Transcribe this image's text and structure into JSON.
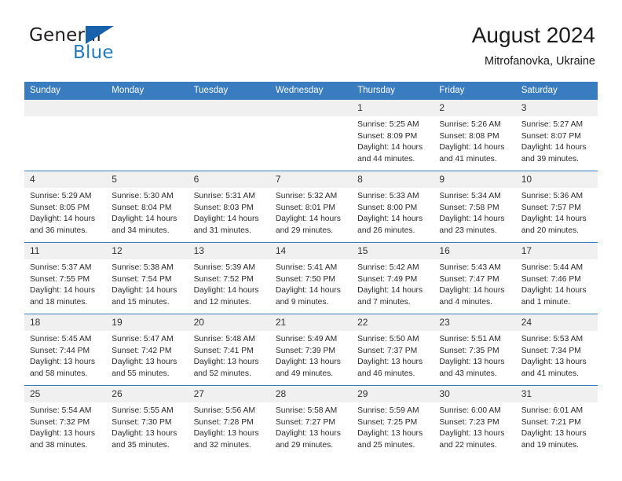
{
  "brand": {
    "name_part1": "General",
    "name_part2": "Blue",
    "triangle_color": "#1862ab",
    "blue_text_color": "#1f7bc1"
  },
  "header": {
    "title": "August 2024",
    "subtitle": "Mitrofanovka, Ukraine"
  },
  "theme": {
    "header_row_bg": "#3a7cc0",
    "daynum_bg": "#f0f0f0",
    "grid_line": "#3a7cc0",
    "text": "#2b2b2b"
  },
  "weekday_headers": [
    "Sunday",
    "Monday",
    "Tuesday",
    "Wednesday",
    "Thursday",
    "Friday",
    "Saturday"
  ],
  "labels": {
    "sunrise_prefix": "Sunrise:",
    "sunset_prefix": "Sunset:",
    "daylight_prefix": "Daylight:"
  },
  "weeks": [
    [
      {
        "day": "",
        "empty": true
      },
      {
        "day": "",
        "empty": true
      },
      {
        "day": "",
        "empty": true
      },
      {
        "day": "",
        "empty": true
      },
      {
        "day": "1",
        "sunrise": "Sunrise: 5:25 AM",
        "sunset": "Sunset: 8:09 PM",
        "daylight": "Daylight: 14 hours and 44 minutes."
      },
      {
        "day": "2",
        "sunrise": "Sunrise: 5:26 AM",
        "sunset": "Sunset: 8:08 PM",
        "daylight": "Daylight: 14 hours and 41 minutes."
      },
      {
        "day": "3",
        "sunrise": "Sunrise: 5:27 AM",
        "sunset": "Sunset: 8:07 PM",
        "daylight": "Daylight: 14 hours and 39 minutes."
      }
    ],
    [
      {
        "day": "4",
        "sunrise": "Sunrise: 5:29 AM",
        "sunset": "Sunset: 8:05 PM",
        "daylight": "Daylight: 14 hours and 36 minutes."
      },
      {
        "day": "5",
        "sunrise": "Sunrise: 5:30 AM",
        "sunset": "Sunset: 8:04 PM",
        "daylight": "Daylight: 14 hours and 34 minutes."
      },
      {
        "day": "6",
        "sunrise": "Sunrise: 5:31 AM",
        "sunset": "Sunset: 8:03 PM",
        "daylight": "Daylight: 14 hours and 31 minutes."
      },
      {
        "day": "7",
        "sunrise": "Sunrise: 5:32 AM",
        "sunset": "Sunset: 8:01 PM",
        "daylight": "Daylight: 14 hours and 29 minutes."
      },
      {
        "day": "8",
        "sunrise": "Sunrise: 5:33 AM",
        "sunset": "Sunset: 8:00 PM",
        "daylight": "Daylight: 14 hours and 26 minutes."
      },
      {
        "day": "9",
        "sunrise": "Sunrise: 5:34 AM",
        "sunset": "Sunset: 7:58 PM",
        "daylight": "Daylight: 14 hours and 23 minutes."
      },
      {
        "day": "10",
        "sunrise": "Sunrise: 5:36 AM",
        "sunset": "Sunset: 7:57 PM",
        "daylight": "Daylight: 14 hours and 20 minutes."
      }
    ],
    [
      {
        "day": "11",
        "sunrise": "Sunrise: 5:37 AM",
        "sunset": "Sunset: 7:55 PM",
        "daylight": "Daylight: 14 hours and 18 minutes."
      },
      {
        "day": "12",
        "sunrise": "Sunrise: 5:38 AM",
        "sunset": "Sunset: 7:54 PM",
        "daylight": "Daylight: 14 hours and 15 minutes."
      },
      {
        "day": "13",
        "sunrise": "Sunrise: 5:39 AM",
        "sunset": "Sunset: 7:52 PM",
        "daylight": "Daylight: 14 hours and 12 minutes."
      },
      {
        "day": "14",
        "sunrise": "Sunrise: 5:41 AM",
        "sunset": "Sunset: 7:50 PM",
        "daylight": "Daylight: 14 hours and 9 minutes."
      },
      {
        "day": "15",
        "sunrise": "Sunrise: 5:42 AM",
        "sunset": "Sunset: 7:49 PM",
        "daylight": "Daylight: 14 hours and 7 minutes."
      },
      {
        "day": "16",
        "sunrise": "Sunrise: 5:43 AM",
        "sunset": "Sunset: 7:47 PM",
        "daylight": "Daylight: 14 hours and 4 minutes."
      },
      {
        "day": "17",
        "sunrise": "Sunrise: 5:44 AM",
        "sunset": "Sunset: 7:46 PM",
        "daylight": "Daylight: 14 hours and 1 minute."
      }
    ],
    [
      {
        "day": "18",
        "sunrise": "Sunrise: 5:45 AM",
        "sunset": "Sunset: 7:44 PM",
        "daylight": "Daylight: 13 hours and 58 minutes."
      },
      {
        "day": "19",
        "sunrise": "Sunrise: 5:47 AM",
        "sunset": "Sunset: 7:42 PM",
        "daylight": "Daylight: 13 hours and 55 minutes."
      },
      {
        "day": "20",
        "sunrise": "Sunrise: 5:48 AM",
        "sunset": "Sunset: 7:41 PM",
        "daylight": "Daylight: 13 hours and 52 minutes."
      },
      {
        "day": "21",
        "sunrise": "Sunrise: 5:49 AM",
        "sunset": "Sunset: 7:39 PM",
        "daylight": "Daylight: 13 hours and 49 minutes."
      },
      {
        "day": "22",
        "sunrise": "Sunrise: 5:50 AM",
        "sunset": "Sunset: 7:37 PM",
        "daylight": "Daylight: 13 hours and 46 minutes."
      },
      {
        "day": "23",
        "sunrise": "Sunrise: 5:51 AM",
        "sunset": "Sunset: 7:35 PM",
        "daylight": "Daylight: 13 hours and 43 minutes."
      },
      {
        "day": "24",
        "sunrise": "Sunrise: 5:53 AM",
        "sunset": "Sunset: 7:34 PM",
        "daylight": "Daylight: 13 hours and 41 minutes."
      }
    ],
    [
      {
        "day": "25",
        "sunrise": "Sunrise: 5:54 AM",
        "sunset": "Sunset: 7:32 PM",
        "daylight": "Daylight: 13 hours and 38 minutes."
      },
      {
        "day": "26",
        "sunrise": "Sunrise: 5:55 AM",
        "sunset": "Sunset: 7:30 PM",
        "daylight": "Daylight: 13 hours and 35 minutes."
      },
      {
        "day": "27",
        "sunrise": "Sunrise: 5:56 AM",
        "sunset": "Sunset: 7:28 PM",
        "daylight": "Daylight: 13 hours and 32 minutes."
      },
      {
        "day": "28",
        "sunrise": "Sunrise: 5:58 AM",
        "sunset": "Sunset: 7:27 PM",
        "daylight": "Daylight: 13 hours and 29 minutes."
      },
      {
        "day": "29",
        "sunrise": "Sunrise: 5:59 AM",
        "sunset": "Sunset: 7:25 PM",
        "daylight": "Daylight: 13 hours and 25 minutes."
      },
      {
        "day": "30",
        "sunrise": "Sunrise: 6:00 AM",
        "sunset": "Sunset: 7:23 PM",
        "daylight": "Daylight: 13 hours and 22 minutes."
      },
      {
        "day": "31",
        "sunrise": "Sunrise: 6:01 AM",
        "sunset": "Sunset: 7:21 PM",
        "daylight": "Daylight: 13 hours and 19 minutes."
      }
    ]
  ]
}
